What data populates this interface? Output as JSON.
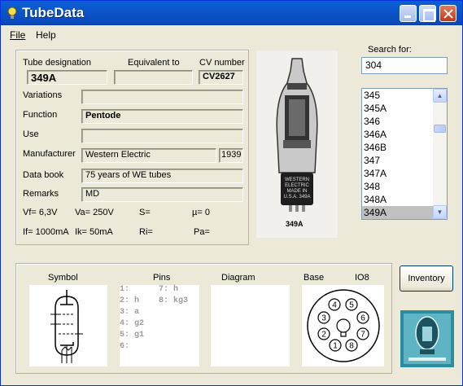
{
  "window": {
    "title": "TubeData"
  },
  "menu": {
    "file": "File",
    "help": "Help"
  },
  "details": {
    "designation_label": "Tube designation",
    "designation": "349A",
    "equivalent_label": "Equivalent to",
    "equivalent": "",
    "cv_label": "CV number",
    "cv": "CV2627",
    "variations_label": "Variations",
    "variations": "",
    "function_label": "Function",
    "function": "Pentode",
    "use_label": "Use",
    "use": "",
    "manufacturer_label": "Manufacturer",
    "manufacturer": "Western Electric",
    "year": "1939",
    "databook_label": "Data book",
    "databook": "75 years of WE tubes",
    "remarks_label": "Remarks",
    "remarks": "MD",
    "vf": "Vf= 6,3V",
    "va": "Va=  250V",
    "s": "S=",
    "mu": "µ=    0",
    "if": "If= 1000mA",
    "ik": "Ik=  50mA",
    "ri": "Ri=",
    "pa": "Pa="
  },
  "photo": {
    "caption": "349A",
    "base_text": "WESTERN ELECTRIC MADE IN U.S.A. 349A"
  },
  "search": {
    "label": "Search for:",
    "value": "304"
  },
  "tube_list": {
    "items": [
      "345",
      "345A",
      "346",
      "346A",
      "346B",
      "347",
      "347A",
      "348",
      "348A",
      "349A"
    ],
    "selected": "349A"
  },
  "bottom": {
    "symbol_label": "Symbol",
    "pins_label": "Pins",
    "diagram_label": "Diagram",
    "base_label": "Base",
    "base_type": "IO8",
    "pins_left": [
      "1:",
      "2: h",
      "3: a",
      "4: g2",
      "5: g1",
      "6:"
    ],
    "pins_right": [
      "7: h",
      "8: kg3"
    ],
    "base_pins": [
      "1",
      "2",
      "3",
      "4",
      "5",
      "6",
      "7",
      "8"
    ]
  },
  "buttons": {
    "inventory": "Inventory"
  }
}
